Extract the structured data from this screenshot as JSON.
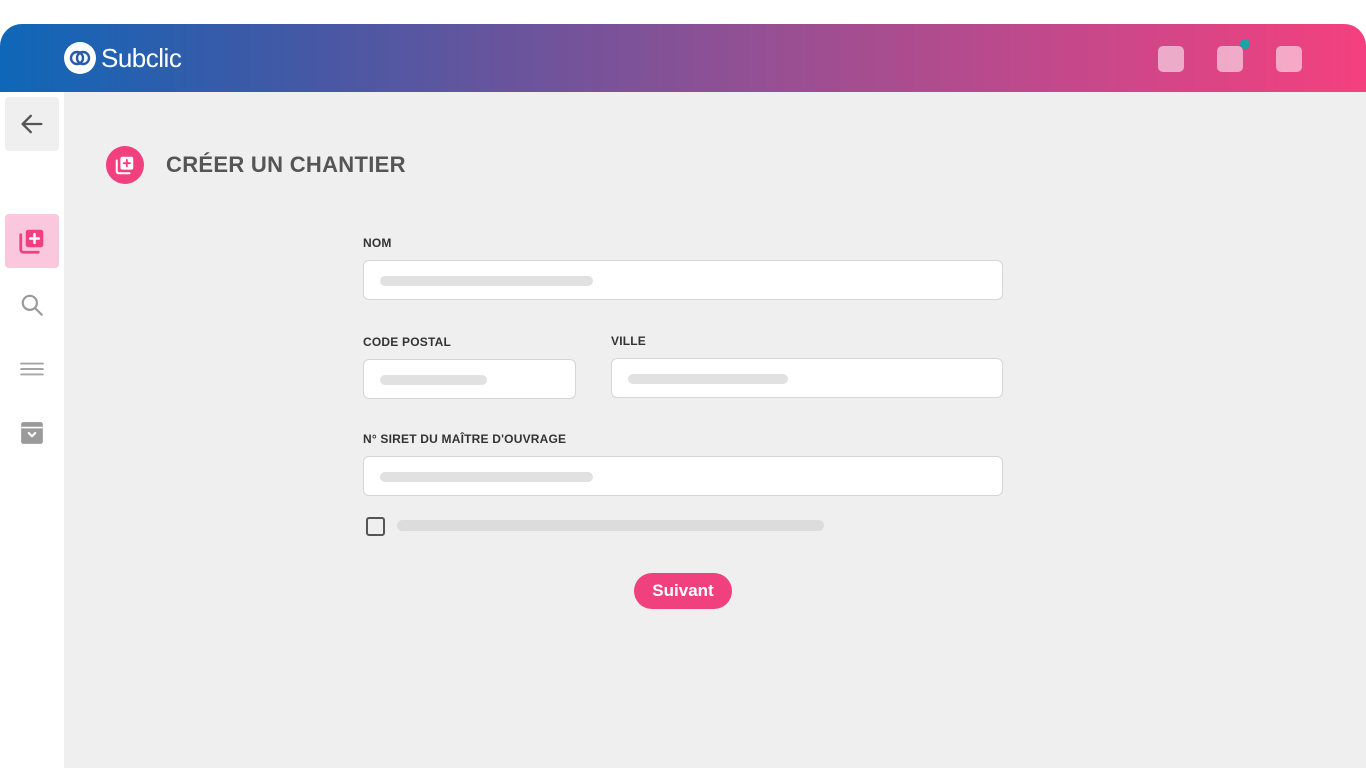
{
  "app": {
    "brand_name": "Subclic"
  },
  "colors": {
    "accent": "#f0407e",
    "notification": "#19a4a6",
    "gradient_start": "#0f67b8",
    "gradient_end": "#f5407e"
  },
  "header": {
    "icons": [
      "header-icon-1",
      "header-icon-2-notification",
      "header-icon-3"
    ]
  },
  "sidebar": {
    "items": [
      {
        "id": "back",
        "icon": "arrow-left-icon"
      },
      {
        "id": "new-site",
        "icon": "add-library-icon",
        "active": true
      },
      {
        "id": "search",
        "icon": "search-icon"
      },
      {
        "id": "list",
        "icon": "menu-lines-icon"
      },
      {
        "id": "archive",
        "icon": "archive-icon"
      }
    ]
  },
  "page": {
    "title": "CRÉER UN CHANTIER",
    "icon": "add-library-icon"
  },
  "form": {
    "nom_label": "NOM",
    "code_postal_label": "CODE POSTAL",
    "ville_label": "VILLE",
    "siret_label": "N° SIRET DU MAÎTRE D'OUVRAGE",
    "checkbox_checked": false,
    "submit_label": "Suivant"
  }
}
